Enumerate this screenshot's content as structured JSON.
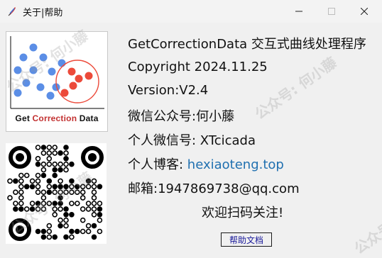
{
  "window": {
    "title": "关于|帮助",
    "icon": "app-icon"
  },
  "logo": {
    "caption_prefix": "Get ",
    "caption_highlight": "Correction",
    "caption_suffix": " Data",
    "highlight_color": "#c23030",
    "blue_color": "#5b8ee6",
    "red_color": "#ec4a3a"
  },
  "info": {
    "line1": "GetCorrectionData 交互式曲线处理程序",
    "line2": "Copyright 2024.11.25",
    "line3": "Version:V2.4",
    "line4": "微信公众号:何小藤",
    "line5": "个人微信号: XTcicada",
    "line6_label": "个人博客: ",
    "line6_link": "hexiaoteng.top",
    "line7": "邮箱:1947869738@qq.com",
    "line8": "欢迎扫码关注!"
  },
  "help_button": {
    "label": "帮助文档"
  },
  "watermark": {
    "text": "公众号: 何小藤"
  }
}
